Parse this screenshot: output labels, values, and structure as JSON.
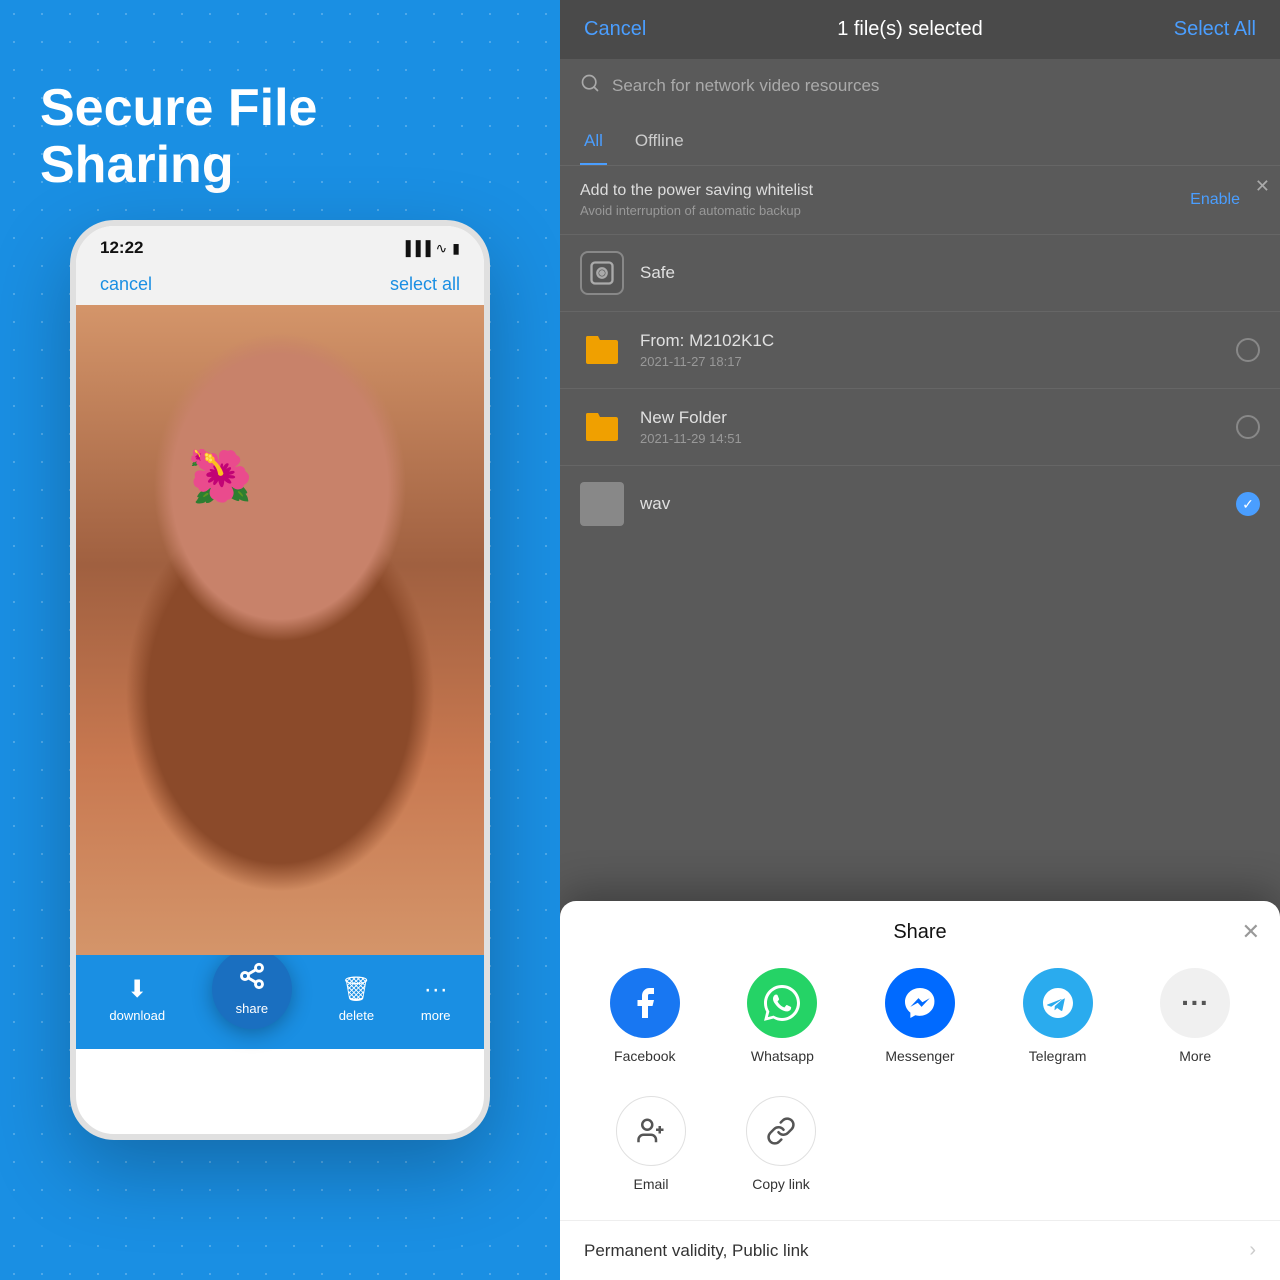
{
  "left": {
    "title": "Secure File Sharing",
    "phone": {
      "time": "12:22",
      "cancel_label": "cancel",
      "select_all_label": "select all",
      "bottom_actions": [
        {
          "id": "download",
          "label": "download",
          "icon": "⬇"
        },
        {
          "id": "share",
          "label": "share",
          "icon": "⟲"
        },
        {
          "id": "delete",
          "label": "delete",
          "icon": "🗑"
        },
        {
          "id": "more",
          "label": "more",
          "icon": "···"
        }
      ]
    }
  },
  "right": {
    "top_bar": {
      "cancel_label": "Cancel",
      "title": "1 file(s) selected",
      "select_all_label": "Select All"
    },
    "search": {
      "placeholder": "Search for network video resources"
    },
    "tabs": [
      {
        "id": "all",
        "label": "All",
        "active": true
      },
      {
        "id": "offline",
        "label": "Offline",
        "active": false
      }
    ],
    "whitelist_banner": {
      "title": "Add to the power saving whitelist",
      "subtitle": "Avoid interruption of automatic backup",
      "enable_label": "Enable"
    },
    "files": [
      {
        "id": "safe",
        "name": "Safe",
        "icon": "safe",
        "date": ""
      },
      {
        "id": "m2102k1c",
        "name": "From: M2102K1C",
        "icon": "folder",
        "date": "2021-11-27  18:17",
        "checked": false
      },
      {
        "id": "new-folder",
        "name": "New Folder",
        "icon": "folder",
        "date": "2021-11-29  14:51",
        "checked": false
      },
      {
        "id": "wav",
        "name": "wav",
        "icon": "wav",
        "date": "",
        "checked": true
      }
    ],
    "share_modal": {
      "title": "Share",
      "apps": [
        {
          "id": "facebook",
          "label": "Facebook",
          "bg": "facebook"
        },
        {
          "id": "whatsapp",
          "label": "Whatsapp",
          "bg": "whatsapp"
        },
        {
          "id": "messenger",
          "label": "Messenger",
          "bg": "messenger"
        },
        {
          "id": "telegram",
          "label": "Telegram",
          "bg": "telegram"
        },
        {
          "id": "more",
          "label": "More",
          "bg": "more"
        }
      ],
      "actions": [
        {
          "id": "email",
          "label": "Email",
          "icon": "👤+"
        },
        {
          "id": "copy-link",
          "label": "Copy link",
          "icon": "🔗"
        }
      ],
      "permanent_link_label": "Permanent validity, Public link"
    }
  }
}
